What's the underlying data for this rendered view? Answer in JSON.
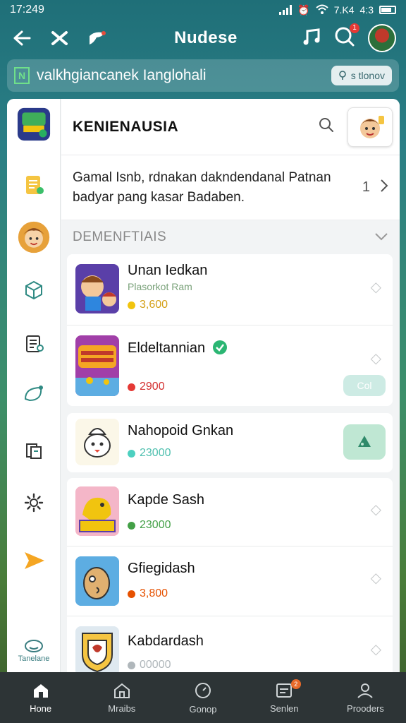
{
  "status": {
    "time": "17:249",
    "right_text": "7.K4 ",
    "battery_text": "4:3"
  },
  "appbar": {
    "title": "Nudese",
    "notif_count": "1"
  },
  "search": {
    "query": "valkhgiancanek Ianglohali",
    "chip_label": "s tlonov"
  },
  "panel": {
    "header_title": "KENIENAUSIA",
    "notice_text": "Gamal Isnb, rdnakan dakndendanal Patnan badyar pang kasar Badaben.",
    "notice_count": "1",
    "section_title": "DEMENFTIAIS",
    "sidebar_bottom_label": "Tanelane",
    "items": [
      {
        "name": "Unan Iedkan",
        "sub": "Plasorkot Ram",
        "points": "3,600",
        "dot_color": "#f1c40f",
        "points_color": "#d4a017"
      },
      {
        "name": "Eldeltannian",
        "sub": "",
        "points": "2900",
        "dot_color": "#e53935",
        "points_color": "#d32f2f",
        "action": "Col"
      },
      {
        "name": "Nahopoid Gnkan",
        "sub": "",
        "points": "23000",
        "dot_color": "#4dd0c0",
        "points_color": "#4dbfae"
      },
      {
        "name": "Kapde Sash",
        "sub": "",
        "points": "23000",
        "dot_color": "#43a047",
        "points_color": "#43a047"
      },
      {
        "name": "Gfiegidash",
        "sub": "",
        "points": "3,800",
        "dot_color": "#e65100",
        "points_color": "#e65100"
      },
      {
        "name": "Kabdardash",
        "sub": "",
        "points": "00000",
        "dot_color": "#b0b7bb",
        "points_color": "#b0b7bb"
      }
    ]
  },
  "bottom_nav": [
    {
      "label": "Hone"
    },
    {
      "label": "Mraibs"
    },
    {
      "label": "Gonop"
    },
    {
      "label": "Senlen",
      "badge": "2"
    },
    {
      "label": "Prooders"
    }
  ],
  "colors": {
    "accent": "#2b7f86",
    "verified": "#2bb673",
    "nav_bg": "#2d3436"
  }
}
